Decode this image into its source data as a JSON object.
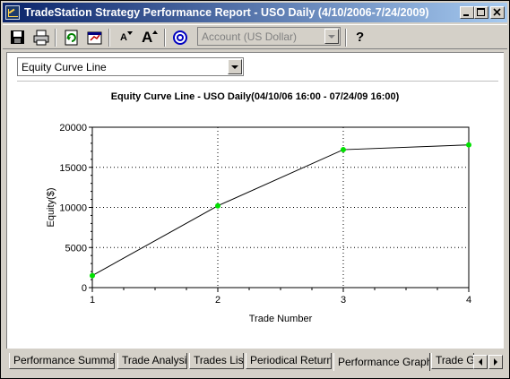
{
  "window": {
    "title": "TradeStation Strategy Performance Report - USO Daily (4/10/2006-7/24/2009)",
    "controls": [
      "minimize-icon",
      "maximize-icon",
      "close-icon"
    ]
  },
  "toolbar": {
    "buttons": [
      "save-icon",
      "print-icon",
      "refresh-icon",
      "options-icon",
      "font-decrease-icon",
      "font-increase-icon",
      "target-icon",
      "help-icon"
    ],
    "help_label": "?",
    "font_decrease_label": "A",
    "font_increase_label": "A",
    "account_select": {
      "value": "Account (US Dollar)",
      "disabled": true
    }
  },
  "graph_select": {
    "value": "Equity Curve Line"
  },
  "chart_data": {
    "type": "line",
    "title": "Equity Curve Line - USO Daily(04/10/06 16:00 - 07/24/09 16:00)",
    "xlabel": "Trade Number",
    "ylabel": "Equity($)",
    "x": [
      1,
      2,
      3,
      4
    ],
    "series": [
      {
        "values": [
          1500,
          10200,
          17200,
          17800
        ],
        "line_color": "#000000",
        "marker_color": "#00e000"
      }
    ],
    "xlim": [
      1,
      4
    ],
    "ylim": [
      0,
      20000
    ],
    "xticks": [
      "1",
      "2",
      "3",
      "4"
    ],
    "yticks": [
      "0",
      "5000",
      "10000",
      "15000",
      "20000"
    ],
    "grid": true
  },
  "tabs": [
    {
      "label": "Performance Summary",
      "active": false
    },
    {
      "label": "Trade Analysis",
      "active": false
    },
    {
      "label": "Trades List",
      "active": false
    },
    {
      "label": "Periodical Returns",
      "active": false
    },
    {
      "label": "Performance Graphs",
      "active": true
    },
    {
      "label": "Trade Gr",
      "active": false
    }
  ],
  "tab_scroll": [
    "scroll-left-icon",
    "scroll-right-icon"
  ]
}
